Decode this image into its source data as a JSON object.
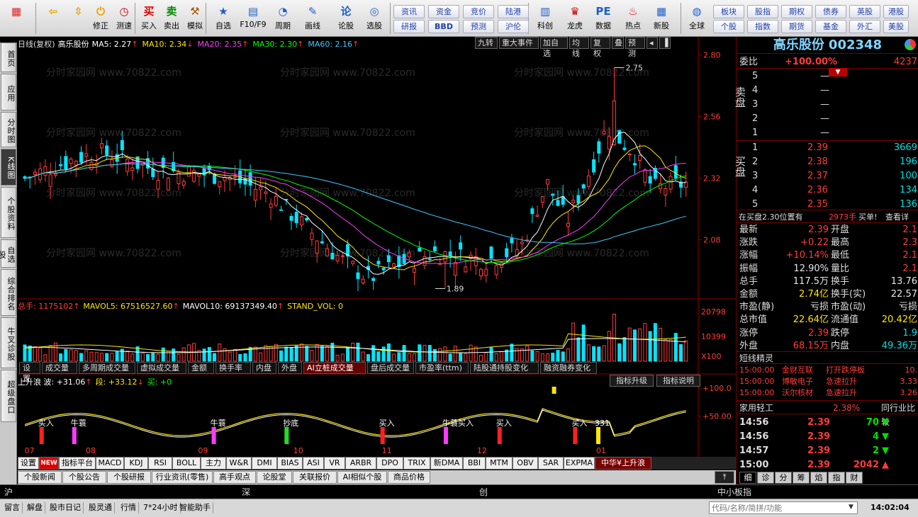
{
  "toolbar": {
    "left_buttons": [
      {
        "label": "",
        "icon": "app-logo-icon"
      },
      {
        "label": "",
        "icon": "back-arrow-icon"
      },
      {
        "label": "",
        "icon": "up-down-icon"
      },
      {
        "label": "修正",
        "icon": "power-icon"
      },
      {
        "label": "测速",
        "icon": "clock-icon"
      },
      {
        "label": "买入",
        "icon": "buy-icon",
        "glyph": "买"
      },
      {
        "label": "卖出",
        "icon": "sell-icon",
        "glyph": "卖"
      },
      {
        "label": "模拟",
        "icon": "hammer-icon"
      },
      {
        "label": "自选",
        "icon": "star-icon"
      },
      {
        "label": "F10/F9",
        "icon": "f10-icon"
      },
      {
        "label": "周期",
        "icon": "period-icon"
      },
      {
        "label": "画线",
        "icon": "pencil-icon"
      },
      {
        "label": "论股",
        "icon": "discuss-icon",
        "glyph": "论"
      },
      {
        "label": "选股",
        "icon": "select-stock-icon"
      }
    ],
    "links_row1": [
      "资讯",
      "资金",
      "竞价",
      "陆港"
    ],
    "links_row2": [
      "研报",
      "BBD",
      "预测",
      "沪伦"
    ],
    "right_buttons": [
      {
        "label": "科创",
        "icon": "kechuang-icon"
      },
      {
        "label": "龙虎",
        "icon": "dragon-icon"
      },
      {
        "label": "数据",
        "icon": "pe-icon",
        "glyph": "PE"
      },
      {
        "label": "热点",
        "icon": "hot-icon"
      },
      {
        "label": "新股",
        "icon": "new-stock-icon"
      },
      {
        "label": "全球",
        "icon": "globe-icon"
      }
    ],
    "links2_row1": [
      "板块",
      "股指",
      "期权",
      "债券",
      "英股",
      "港股"
    ],
    "links2_row2": [
      "个股",
      "指数",
      "期货",
      "基金",
      "外汇",
      "美股"
    ]
  },
  "left_tabs": [
    "首页",
    "应用",
    "分时图",
    "K线图",
    "个股资料",
    "自选股",
    "综合排名",
    "牛叉诊股",
    "超级盘口"
  ],
  "chart": {
    "header": {
      "period": "日线(复权)",
      "stock_name": "高乐股份",
      "ma": [
        {
          "label": "MA5: 2.27",
          "arrow": "↑",
          "color": "#ffffff"
        },
        {
          "label": "MA10: 2.34",
          "arrow": "↓",
          "color": "#ffe600"
        },
        {
          "label": "MA20: 2.35",
          "arrow": "↑",
          "color": "#ff3bff"
        },
        {
          "label": "MA30: 2.30",
          "arrow": "↑",
          "color": "#00ff00"
        },
        {
          "label": "MA60: 2.16",
          "arrow": "↑",
          "color": "#3fc7ff"
        }
      ]
    },
    "controls": [
      "九转",
      "重大事件",
      "加自选",
      "均线",
      "复权",
      "叠",
      "预测"
    ],
    "price_axis": [
      "2.80",
      "2.56",
      "2.32",
      "2.08"
    ],
    "high_label": "2.75",
    "low_label": "1.89",
    "watermark": "分时家园网 www.70822.com",
    "volume": {
      "header": [
        {
          "label": "总手: 1175102",
          "arrow": "↑",
          "color": "#ff3b3b"
        },
        {
          "label": "MAVOL5: 67516527.60",
          "arrow": "↑",
          "color": "#ffe600"
        },
        {
          "label": "MAVOL10: 69137349.40",
          "arrow": "↑",
          "color": "#ffffff"
        },
        {
          "label": "STAND_VOL: 0",
          "arrow": "",
          "color": "#ffe600"
        }
      ],
      "axis": [
        "20798",
        "10399",
        "X100"
      ]
    },
    "sub_tabs": [
      "设置",
      "成交量",
      "多周期成交量",
      "虚拟成交量",
      "金额",
      "换手率",
      "内盘",
      "外盘",
      "AI立桩成交量",
      "盘后成交量",
      "市盈率(ttm)",
      "陆股通持股变化",
      "融资融券变化"
    ],
    "active_sub_tab": "AI立桩成交量",
    "indicator": {
      "header": [
        {
          "label": "上升浪 波: +31.06",
          "arrow": "↑",
          "color": "#ffffff"
        },
        {
          "label": "段: +33.12",
          "arrow": "↓",
          "color": "#ffe600"
        },
        {
          "label": "买: +0",
          "arrow": "",
          "color": "#00ff00"
        }
      ],
      "buttons": [
        "指标升级",
        "指标说明"
      ],
      "axis": [
        "+100.0",
        "+50.00"
      ],
      "signals": [
        {
          "text": "买入",
          "x": 0.032,
          "color": "#ff2020"
        },
        {
          "text": "牛蓑",
          "x": 0.08,
          "color": "#ff3bff"
        },
        {
          "text": "牛蓑",
          "x": 0.285,
          "color": "#ff3bff"
        },
        {
          "text": "抄底",
          "x": 0.392,
          "color": "#22dd22"
        },
        {
          "text": "买入",
          "x": 0.533,
          "color": "#ff2020"
        },
        {
          "text": "牛蓑买入",
          "x": 0.626,
          "color": "#ff3bff"
        },
        {
          "text": "买入",
          "x": 0.705,
          "color": "#ff2020"
        },
        {
          "text": "买入",
          "x": 0.816,
          "color": "#ff2020"
        },
        {
          "text": "331",
          "x": 0.85,
          "color": "#ffe600"
        }
      ]
    },
    "months": [
      "07",
      "08",
      "09",
      "10",
      "11",
      "12",
      "01"
    ]
  },
  "indicator_bar": [
    "设置",
    "NEW",
    "指标平台",
    "MACD",
    "KDJ",
    "RSI",
    "BOLL",
    "主力",
    "W&R",
    "DMI",
    "BIAS",
    "ASI",
    "VR",
    "ARBR",
    "DPO",
    "TRIX",
    "新DMA",
    "BBI",
    "MTM",
    "OBV",
    "SAR",
    "EXPMA",
    "中华¥上升浪"
  ],
  "news_bar": [
    "个股新闻",
    "个股公告",
    "个股研报",
    "行业资讯(零售)",
    "高手观点",
    "论股堂",
    "关联报价",
    "AI相似个股",
    "商品价格"
  ],
  "quote": {
    "title": "高乐股份",
    "code": "002348",
    "weibi_label": "委比",
    "weibi_value": "+100.00%",
    "weicha_value": "4237",
    "sell_label": "卖盘",
    "buy_label": "买盘",
    "sell": [
      {
        "level": "5",
        "price": "",
        "vol": "—"
      },
      {
        "level": "4",
        "price": "",
        "vol": "—"
      },
      {
        "level": "3",
        "price": "",
        "vol": "—"
      },
      {
        "level": "2",
        "price": "",
        "vol": "—"
      },
      {
        "level": "1",
        "price": "",
        "vol": "—"
      }
    ],
    "buy": [
      {
        "level": "1",
        "price": "2.39",
        "vol": "3669"
      },
      {
        "level": "2",
        "price": "2.38",
        "vol": "196"
      },
      {
        "level": "3",
        "price": "2.37",
        "vol": "100"
      },
      {
        "level": "4",
        "price": "2.36",
        "vol": "134"
      },
      {
        "level": "5",
        "price": "2.35",
        "vol": "136"
      }
    ],
    "info_line": "在买盘2.30位置有",
    "info_vol": "2973手",
    "info_action": "买单!",
    "info_link": "查看详",
    "stats": [
      {
        "l1": "最新",
        "v1": "2.39",
        "c1": "red",
        "l2": "开盘",
        "v2": "2.1",
        "c2": "red"
      },
      {
        "l1": "涨跌",
        "v1": "+0.22",
        "c1": "red",
        "l2": "最高",
        "v2": "2.3",
        "c2": "red"
      },
      {
        "l1": "涨幅",
        "v1": "+10.14%",
        "c1": "red",
        "l2": "最低",
        "v2": "2.1",
        "c2": "red"
      },
      {
        "l1": "振幅",
        "v1": "12.90%",
        "c1": "wht",
        "l2": "量比",
        "v2": "2.1",
        "c2": "red"
      },
      {
        "l1": "总手",
        "v1": "117.5万",
        "c1": "wht",
        "l2": "换手",
        "v2": "13.76",
        "c2": "wht"
      },
      {
        "l1": "金额",
        "v1": "2.74亿",
        "c1": "yel",
        "l2": "换手(实)",
        "v2": "22.57",
        "c2": "wht"
      },
      {
        "l1": "市盈(静)",
        "v1": "亏损",
        "c1": "wht",
        "l2": "市盈(动)",
        "v2": "亏损",
        "c2": "wht"
      },
      {
        "l1": "总市值",
        "v1": "22.64亿",
        "c1": "yel",
        "l2": "流通值",
        "v2": "20.42亿",
        "c2": "yel"
      },
      {
        "l1": "涨停",
        "v1": "2.39",
        "c1": "red",
        "l2": "跌停",
        "v2": "1.9",
        "c2": "grn"
      },
      {
        "l1": "外盘",
        "v1": "68.15万",
        "c1": "red",
        "l2": "内盘",
        "v2": "49.36万",
        "c2": "grn"
      }
    ],
    "elves_title": "短线精灵",
    "elves": [
      {
        "time": "15:00:00",
        "name": "金财互联",
        "event": "打开跌停板",
        "value": "10."
      },
      {
        "time": "15:00:00",
        "name": "博敏电子",
        "event": "急速拉升",
        "value": "3.33"
      },
      {
        "time": "15:00:00",
        "name": "沃尔核材",
        "event": "急速拉升",
        "value": "3.26"
      }
    ],
    "industry": "家用轻工",
    "industry_pct": "2.38%",
    "industry_link": "同行业比较",
    "ticks": [
      {
        "time": "14:56",
        "price": "2.39",
        "vol": "70",
        "dir": "down"
      },
      {
        "time": "14:56",
        "price": "2.39",
        "vol": "4",
        "dir": "down"
      },
      {
        "time": "14:57",
        "price": "2.39",
        "vol": "2",
        "dir": "down"
      },
      {
        "time": "15:00",
        "price": "2.39",
        "vol": "2042",
        "dir": "up"
      }
    ],
    "bottom_tabs": [
      "细",
      "诊",
      "分",
      "筹",
      "焰",
      "指",
      "财"
    ]
  },
  "index_bar": {
    "sh": "沪",
    "sz": "深",
    "cy": "创",
    "smb": "中小板指"
  },
  "status_bar": {
    "items": [
      "留言",
      "解盘",
      "股市日记",
      "股灵通",
      "行情",
      "7*24小时",
      "智能助手"
    ],
    "search_placeholder": "代码/名称/简拼/功能",
    "clock": "14:02:04"
  }
}
